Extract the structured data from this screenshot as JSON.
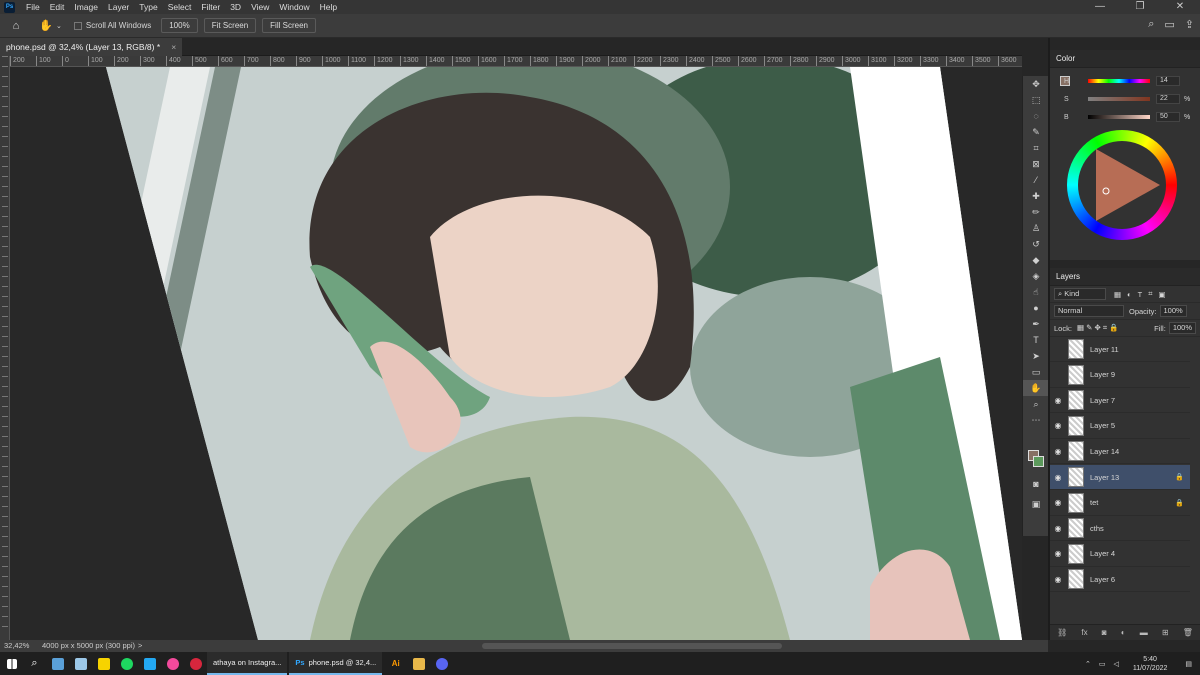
{
  "app": {
    "logo": "Ps"
  },
  "menu": [
    "File",
    "Edit",
    "Image",
    "Layer",
    "Type",
    "Select",
    "Filter",
    "3D",
    "View",
    "Window",
    "Help"
  ],
  "window_controls": [
    "—",
    "❐",
    "✕"
  ],
  "options_bar": {
    "scroll_all_windows": "Scroll All Windows",
    "zoom_button": "100%",
    "fit_screen": "Fit Screen",
    "fill_screen": "Fill Screen"
  },
  "document_tab": {
    "title": "phone.psd @ 32,4% (Layer 13, RGB/8) *",
    "close": "×"
  },
  "ruler_ticks": [
    "200",
    "100",
    "0",
    "100",
    "200",
    "300",
    "400",
    "500",
    "600",
    "700",
    "800",
    "900",
    "1000",
    "1100",
    "1200",
    "1300",
    "1400",
    "1500",
    "1600",
    "1700",
    "1800",
    "1900",
    "2000",
    "2100",
    "2200",
    "2300",
    "2400",
    "2500",
    "2600",
    "2700",
    "2800",
    "2900",
    "3000",
    "3100",
    "3200",
    "3300",
    "3400",
    "3500",
    "3600"
  ],
  "color_panel": {
    "title": "Color",
    "h_label": "H",
    "h_value": "14",
    "s_label": "S",
    "s_value": "22",
    "s_unit": "%",
    "b_label": "B",
    "b_value": "50",
    "b_unit": "%",
    "foreground": "#877064",
    "background": "#5c9a5c"
  },
  "layers_panel": {
    "title": "Layers",
    "filter_kind": "Kind",
    "blend_mode": "Normal",
    "opacity_label": "Opacity:",
    "opacity_value": "100%",
    "lock_label": "Lock:",
    "fill_label": "Fill:",
    "fill_value": "100%",
    "layers": [
      {
        "name": "Layer 11",
        "visible": false,
        "locked": false,
        "selected": false
      },
      {
        "name": "Layer 9",
        "visible": false,
        "locked": false,
        "selected": false
      },
      {
        "name": "Layer 7",
        "visible": true,
        "locked": false,
        "selected": false
      },
      {
        "name": "Layer 5",
        "visible": true,
        "locked": false,
        "selected": false
      },
      {
        "name": "Layer 14",
        "visible": true,
        "locked": false,
        "selected": false
      },
      {
        "name": "Layer 13",
        "visible": true,
        "locked": true,
        "selected": true
      },
      {
        "name": "tet",
        "visible": true,
        "locked": true,
        "selected": false
      },
      {
        "name": "cths",
        "visible": true,
        "locked": false,
        "selected": false
      },
      {
        "name": "Layer 4",
        "visible": true,
        "locked": false,
        "selected": false
      },
      {
        "name": "Layer 6",
        "visible": true,
        "locked": false,
        "selected": false
      }
    ]
  },
  "status_bar": {
    "zoom": "32,42%",
    "doc_size": "4000 px x 5000 px (300 ppi)",
    "chevron": ">"
  },
  "taskbar": {
    "tasks": [
      {
        "label": "athaya on Instagra...",
        "icon_color": "#d7263d"
      },
      {
        "label": "phone.psd @ 32,4...",
        "icon_color": "#31a8ff"
      }
    ],
    "time": "5:40",
    "date": "11/07/2022"
  }
}
